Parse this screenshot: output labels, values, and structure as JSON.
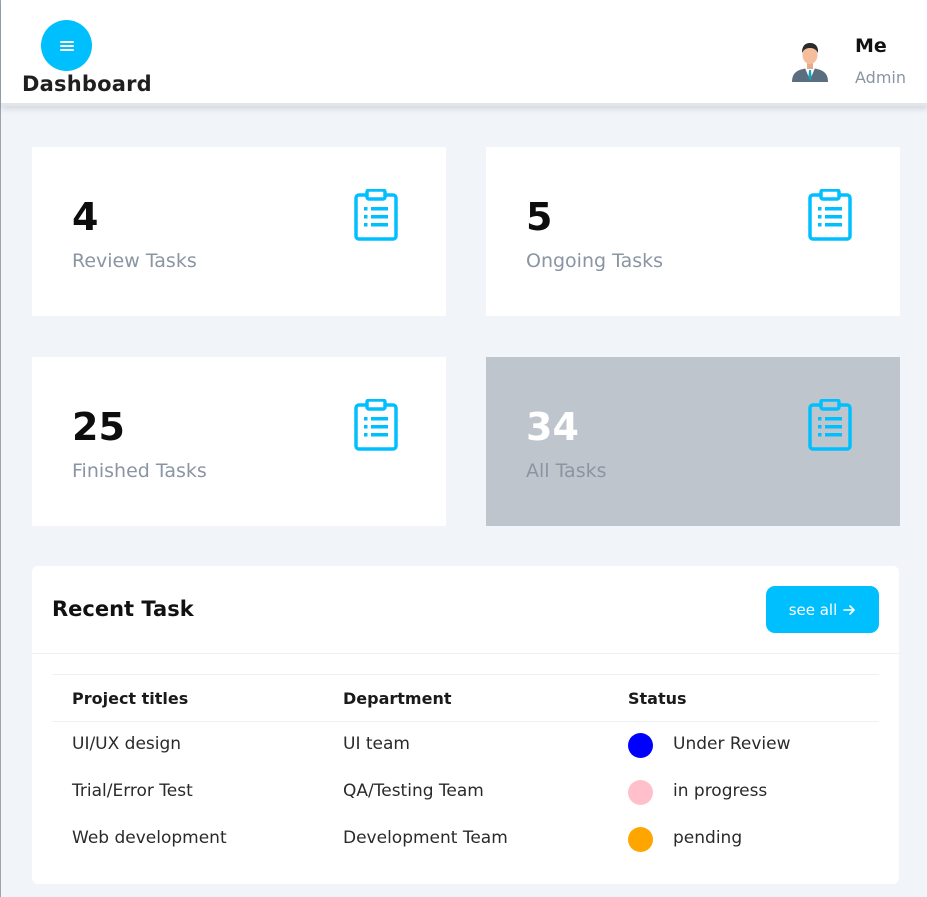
{
  "header": {
    "brand": "Dashboard",
    "menu_icon": "hamburger-menu-icon",
    "user": {
      "name": "Me",
      "role": "Admin",
      "avatar_icon": "user-avatar"
    }
  },
  "colors": {
    "accent": "#00bfff",
    "muted_card": "#bec5cc",
    "background": "#f1f5f9"
  },
  "cards": [
    {
      "value": "4",
      "label": "Review Tasks",
      "icon": "clipboard-icon"
    },
    {
      "value": "5",
      "label": "Ongoing Tasks",
      "icon": "clipboard-icon"
    },
    {
      "value": "25",
      "label": "Finished Tasks",
      "icon": "clipboard-icon"
    },
    {
      "value": "34",
      "label": "All Tasks",
      "icon": "clipboard-icon"
    }
  ],
  "recent": {
    "title": "Recent Task",
    "see_all": "see all",
    "see_all_icon": "arrow-right-icon",
    "columns": [
      "Project titles",
      "Department",
      "Status"
    ],
    "rows": [
      {
        "project": "UI/UX design",
        "department": "UI team",
        "status": "Under Review",
        "status_color": "#0000ff"
      },
      {
        "project": "Trial/Error Test",
        "department": "QA/Testing Team",
        "status": "in progress",
        "status_color": "#ffc0cb"
      },
      {
        "project": "Web development",
        "department": "Development Team",
        "status": "pending",
        "status_color": "#ffa500"
      }
    ]
  }
}
